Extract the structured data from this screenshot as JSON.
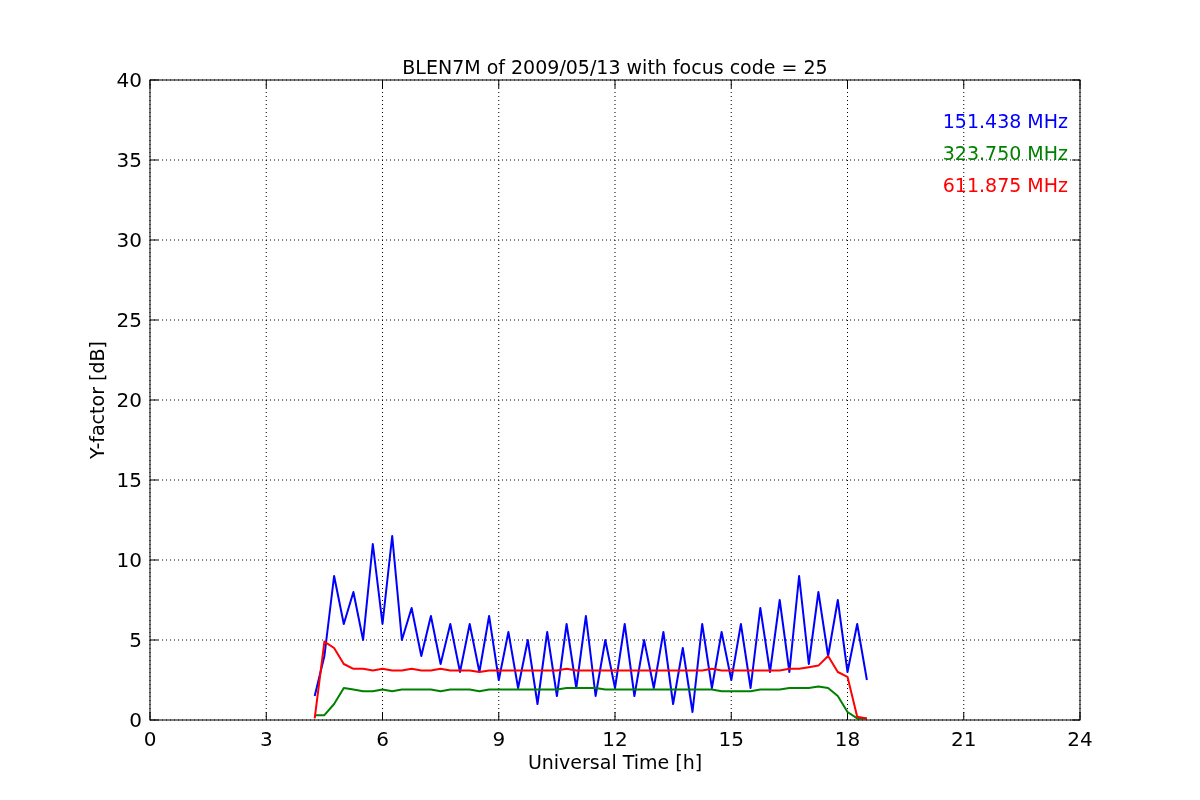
{
  "chart_data": {
    "type": "line",
    "title": "BLEN7M of 2009/05/13 with focus code = 25",
    "xlabel": "Universal Time [h]",
    "ylabel": "Y-factor [dB]",
    "x": [
      4.25,
      4.5,
      4.75,
      5,
      5.25,
      5.5,
      5.75,
      6,
      6.25,
      6.5,
      6.75,
      7,
      7.25,
      7.5,
      7.75,
      8,
      8.25,
      8.5,
      8.75,
      9,
      9.25,
      9.5,
      9.75,
      10,
      10.25,
      10.5,
      10.75,
      11,
      11.25,
      11.5,
      11.75,
      12,
      12.25,
      12.5,
      12.75,
      13,
      13.25,
      13.5,
      13.75,
      14,
      14.25,
      14.5,
      14.75,
      15,
      15.25,
      15.5,
      15.75,
      16,
      16.25,
      16.5,
      16.75,
      17,
      17.25,
      17.5,
      17.75,
      18,
      18.25,
      18.5
    ],
    "series": [
      {
        "name": "151.438 MHz",
        "color": "#0000ff",
        "values": [
          1.5,
          4,
          9,
          6,
          8,
          5,
          11,
          6,
          11.5,
          5,
          7,
          4,
          6.5,
          3.5,
          6,
          3,
          6,
          3,
          6.5,
          2.5,
          5.5,
          2,
          5,
          1,
          5.5,
          1.5,
          6,
          2,
          6.5,
          1.5,
          5,
          2,
          6,
          1.5,
          5,
          2,
          5.5,
          1,
          4.5,
          0.5,
          6,
          2,
          5.5,
          2.5,
          6,
          2,
          7,
          3,
          7.5,
          3,
          9,
          3.5,
          8,
          4,
          7.5,
          3,
          6,
          2.5
        ]
      },
      {
        "name": "323.750 MHz",
        "color": "#008000",
        "values": [
          0.3,
          0.3,
          1,
          2,
          1.9,
          1.8,
          1.8,
          1.9,
          1.8,
          1.9,
          1.9,
          1.9,
          1.9,
          1.8,
          1.9,
          1.9,
          1.9,
          1.8,
          1.9,
          1.9,
          1.9,
          1.9,
          1.9,
          1.9,
          1.9,
          1.9,
          2,
          2,
          2,
          2,
          1.9,
          1.9,
          1.9,
          1.9,
          1.9,
          1.9,
          1.9,
          1.9,
          1.9,
          1.9,
          1.9,
          1.9,
          1.8,
          1.8,
          1.8,
          1.8,
          1.9,
          1.9,
          1.9,
          2,
          2,
          2,
          2.1,
          2,
          1.5,
          0.5,
          0.1,
          0.1
        ]
      },
      {
        "name": "611.875 MHz",
        "color": "#ff0000",
        "values": [
          0.1,
          4.9,
          4.5,
          3.5,
          3.2,
          3.2,
          3.1,
          3.2,
          3.1,
          3.1,
          3.2,
          3.1,
          3.1,
          3.2,
          3.1,
          3.1,
          3.1,
          3,
          3.1,
          3.1,
          3.1,
          3.1,
          3.1,
          3.1,
          3.1,
          3.1,
          3.2,
          3.1,
          3.1,
          3.1,
          3.1,
          3.1,
          3.1,
          3.1,
          3.1,
          3.1,
          3.1,
          3.1,
          3.1,
          3.1,
          3.1,
          3.2,
          3.1,
          3.1,
          3.1,
          3.1,
          3.1,
          3.1,
          3.1,
          3.2,
          3.2,
          3.3,
          3.4,
          4,
          3,
          2.7,
          0.2,
          0.1
        ]
      }
    ],
    "xlim": [
      0,
      24
    ],
    "ylim": [
      0,
      40
    ],
    "xticks": [
      0,
      3,
      6,
      9,
      12,
      15,
      18,
      21,
      24
    ],
    "yticks": [
      0,
      5,
      10,
      15,
      20,
      25,
      30,
      35,
      40
    ],
    "grid": true
  }
}
